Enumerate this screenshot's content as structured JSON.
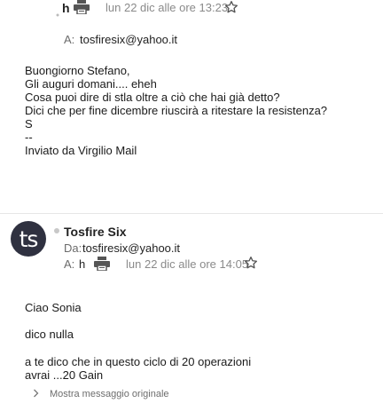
{
  "message1": {
    "sender_partial": "h",
    "date": "lun 22 dic alle ore 13:23",
    "to_label": "A:",
    "to_value": "tosfiresix@yahoo.it",
    "body_lines": [
      "Buongiorno Stefano,",
      "Gli auguri domani.... eheh",
      "Cosa puoi dire di stla oltre a ciò che hai già detto?",
      "Dici che per fine dicembre riuscirà a ritestare la resistenza?",
      "S",
      "--",
      "Inviato da Virgilio Mail"
    ]
  },
  "message2": {
    "avatar_text": "ts",
    "sender": "Tosfire Six",
    "from_label": "Da:",
    "from_value": "tosfiresix@yahoo.it",
    "to_label": "A:",
    "to_value": "h",
    "date": "lun 22 dic alle ore 14:05",
    "body_paragraphs": [
      "Ciao Sonia",
      "dico nulla",
      "a te dico che in questo ciclo di 20 operazioni\navrai ...20 Gain"
    ],
    "show_original": "Mostra messaggio originale"
  },
  "icons": {
    "printer": "printer-icon",
    "star": "star-icon",
    "chevron": "chevron-right-icon"
  }
}
